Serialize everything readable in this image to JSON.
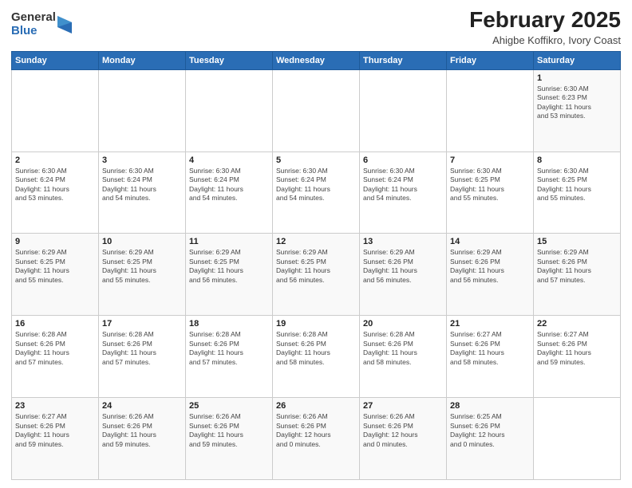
{
  "logo": {
    "general": "General",
    "blue": "Blue"
  },
  "header": {
    "title": "February 2025",
    "subtitle": "Ahigbe Koffikro, Ivory Coast"
  },
  "days_of_week": [
    "Sunday",
    "Monday",
    "Tuesday",
    "Wednesday",
    "Thursday",
    "Friday",
    "Saturday"
  ],
  "weeks": [
    [
      {
        "day": "",
        "info": ""
      },
      {
        "day": "",
        "info": ""
      },
      {
        "day": "",
        "info": ""
      },
      {
        "day": "",
        "info": ""
      },
      {
        "day": "",
        "info": ""
      },
      {
        "day": "",
        "info": ""
      },
      {
        "day": "1",
        "info": "Sunrise: 6:30 AM\nSunset: 6:23 PM\nDaylight: 11 hours\nand 53 minutes."
      }
    ],
    [
      {
        "day": "2",
        "info": "Sunrise: 6:30 AM\nSunset: 6:24 PM\nDaylight: 11 hours\nand 53 minutes."
      },
      {
        "day": "3",
        "info": "Sunrise: 6:30 AM\nSunset: 6:24 PM\nDaylight: 11 hours\nand 54 minutes."
      },
      {
        "day": "4",
        "info": "Sunrise: 6:30 AM\nSunset: 6:24 PM\nDaylight: 11 hours\nand 54 minutes."
      },
      {
        "day": "5",
        "info": "Sunrise: 6:30 AM\nSunset: 6:24 PM\nDaylight: 11 hours\nand 54 minutes."
      },
      {
        "day": "6",
        "info": "Sunrise: 6:30 AM\nSunset: 6:24 PM\nDaylight: 11 hours\nand 54 minutes."
      },
      {
        "day": "7",
        "info": "Sunrise: 6:30 AM\nSunset: 6:25 PM\nDaylight: 11 hours\nand 55 minutes."
      },
      {
        "day": "8",
        "info": "Sunrise: 6:30 AM\nSunset: 6:25 PM\nDaylight: 11 hours\nand 55 minutes."
      }
    ],
    [
      {
        "day": "9",
        "info": "Sunrise: 6:29 AM\nSunset: 6:25 PM\nDaylight: 11 hours\nand 55 minutes."
      },
      {
        "day": "10",
        "info": "Sunrise: 6:29 AM\nSunset: 6:25 PM\nDaylight: 11 hours\nand 55 minutes."
      },
      {
        "day": "11",
        "info": "Sunrise: 6:29 AM\nSunset: 6:25 PM\nDaylight: 11 hours\nand 56 minutes."
      },
      {
        "day": "12",
        "info": "Sunrise: 6:29 AM\nSunset: 6:25 PM\nDaylight: 11 hours\nand 56 minutes."
      },
      {
        "day": "13",
        "info": "Sunrise: 6:29 AM\nSunset: 6:26 PM\nDaylight: 11 hours\nand 56 minutes."
      },
      {
        "day": "14",
        "info": "Sunrise: 6:29 AM\nSunset: 6:26 PM\nDaylight: 11 hours\nand 56 minutes."
      },
      {
        "day": "15",
        "info": "Sunrise: 6:29 AM\nSunset: 6:26 PM\nDaylight: 11 hours\nand 57 minutes."
      }
    ],
    [
      {
        "day": "16",
        "info": "Sunrise: 6:28 AM\nSunset: 6:26 PM\nDaylight: 11 hours\nand 57 minutes."
      },
      {
        "day": "17",
        "info": "Sunrise: 6:28 AM\nSunset: 6:26 PM\nDaylight: 11 hours\nand 57 minutes."
      },
      {
        "day": "18",
        "info": "Sunrise: 6:28 AM\nSunset: 6:26 PM\nDaylight: 11 hours\nand 57 minutes."
      },
      {
        "day": "19",
        "info": "Sunrise: 6:28 AM\nSunset: 6:26 PM\nDaylight: 11 hours\nand 58 minutes."
      },
      {
        "day": "20",
        "info": "Sunrise: 6:28 AM\nSunset: 6:26 PM\nDaylight: 11 hours\nand 58 minutes."
      },
      {
        "day": "21",
        "info": "Sunrise: 6:27 AM\nSunset: 6:26 PM\nDaylight: 11 hours\nand 58 minutes."
      },
      {
        "day": "22",
        "info": "Sunrise: 6:27 AM\nSunset: 6:26 PM\nDaylight: 11 hours\nand 59 minutes."
      }
    ],
    [
      {
        "day": "23",
        "info": "Sunrise: 6:27 AM\nSunset: 6:26 PM\nDaylight: 11 hours\nand 59 minutes."
      },
      {
        "day": "24",
        "info": "Sunrise: 6:26 AM\nSunset: 6:26 PM\nDaylight: 11 hours\nand 59 minutes."
      },
      {
        "day": "25",
        "info": "Sunrise: 6:26 AM\nSunset: 6:26 PM\nDaylight: 11 hours\nand 59 minutes."
      },
      {
        "day": "26",
        "info": "Sunrise: 6:26 AM\nSunset: 6:26 PM\nDaylight: 12 hours\nand 0 minutes."
      },
      {
        "day": "27",
        "info": "Sunrise: 6:26 AM\nSunset: 6:26 PM\nDaylight: 12 hours\nand 0 minutes."
      },
      {
        "day": "28",
        "info": "Sunrise: 6:25 AM\nSunset: 6:26 PM\nDaylight: 12 hours\nand 0 minutes."
      },
      {
        "day": "",
        "info": ""
      }
    ]
  ]
}
